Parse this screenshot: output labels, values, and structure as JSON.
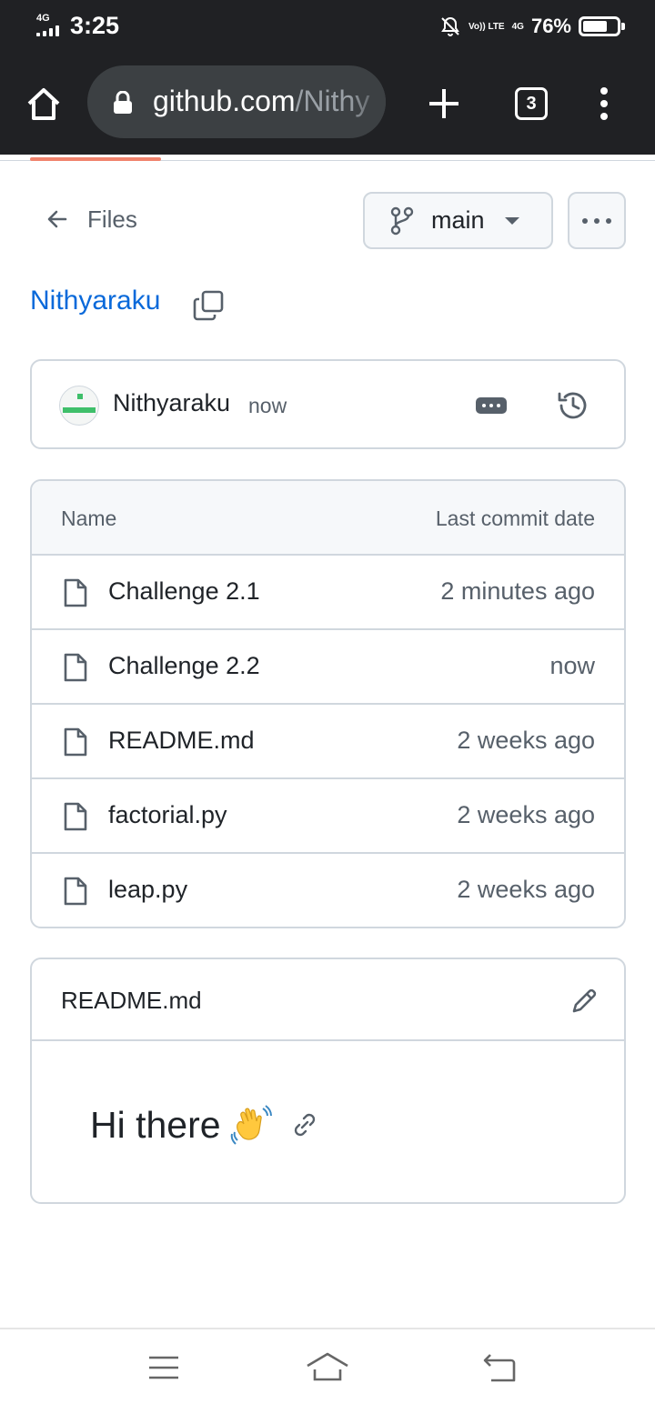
{
  "status_bar": {
    "network": "4G",
    "time": "3:25",
    "volte": "Vo)) LTE",
    "data_network": "4G",
    "battery_percent": "76%",
    "battery_level": 0.76
  },
  "browser": {
    "url_domain": "github.com",
    "url_path": "/Nithy",
    "tab_count": "3",
    "page_load_progress": 0.2
  },
  "nav": {
    "back_label": "Files",
    "branch": "main"
  },
  "repo": {
    "name": "Nithyaraku"
  },
  "commit": {
    "author": "Nithyaraku",
    "time": "now"
  },
  "table": {
    "col_name": "Name",
    "col_date": "Last commit date",
    "rows": [
      {
        "name": "Challenge 2.1",
        "date": "2 minutes ago"
      },
      {
        "name": "Challenge 2.2",
        "date": "now"
      },
      {
        "name": "README.md",
        "date": "2 weeks ago"
      },
      {
        "name": "factorial.py",
        "date": "2 weeks ago"
      },
      {
        "name": "leap.py",
        "date": "2 weeks ago"
      }
    ]
  },
  "readme": {
    "title": "README.md",
    "heading": "Hi there"
  },
  "colors": {
    "link_blue": "#0969da",
    "border": "#d0d7de",
    "muted": "#57606a",
    "toolbar_bg": "#202124",
    "progress_accent": "#f0826c"
  }
}
